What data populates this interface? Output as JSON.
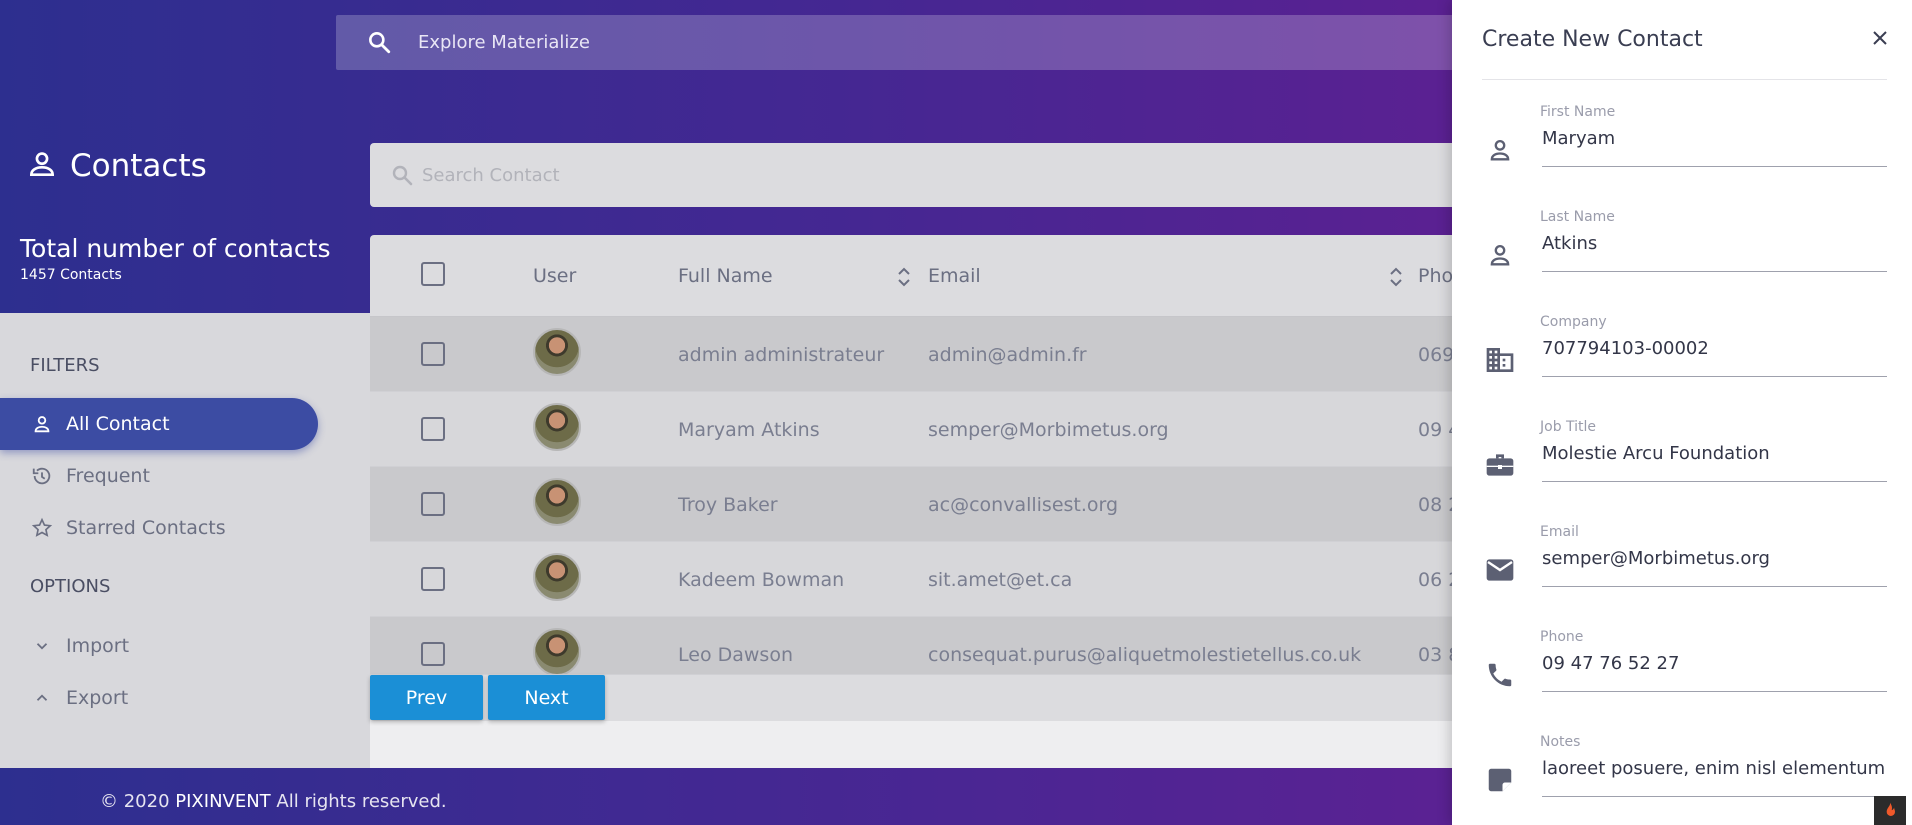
{
  "top_search": {
    "placeholder": "Explore Materialize"
  },
  "page": {
    "title": "Contacts",
    "total_label": "Total number of contacts",
    "total_count": "1457 Contacts"
  },
  "sidebar": {
    "filters_heading": "FILTERS",
    "filters": [
      {
        "label": "All Contact",
        "icon": "person-icon",
        "active": true
      },
      {
        "label": "Frequent",
        "icon": "history-icon",
        "active": false
      },
      {
        "label": "Starred Contacts",
        "icon": "star-icon",
        "active": false
      }
    ],
    "options_heading": "OPTIONS",
    "options": [
      {
        "label": "Import",
        "icon": "chevron-down-icon"
      },
      {
        "label": "Export",
        "icon": "chevron-up-icon"
      }
    ]
  },
  "contact_search": {
    "placeholder": "Search Contact"
  },
  "table": {
    "headers": {
      "user": "User",
      "full_name": "Full Name",
      "email": "Email",
      "phone": "Pho"
    },
    "rows": [
      {
        "name": "admin administrateur",
        "email": "admin@admin.fr",
        "phone": "069"
      },
      {
        "name": "Maryam Atkins",
        "email": "semper@Morbimetus.org",
        "phone": "09 4"
      },
      {
        "name": "Troy Baker",
        "email": "ac@convallisest.org",
        "phone": "08 2"
      },
      {
        "name": "Kadeem Bowman",
        "email": "sit.amet@et.ca",
        "phone": "06 2"
      },
      {
        "name": "Leo Dawson",
        "email": "consequat.purus@aliquetmolestietellus.co.uk",
        "phone": "03 8"
      }
    ]
  },
  "pager": {
    "prev": "Prev",
    "next": "Next"
  },
  "footer": {
    "prefix": "© 2020 ",
    "brand": "PIXINVENT",
    "suffix": " All rights reserved."
  },
  "panel": {
    "title": "Create New Contact",
    "fields": [
      {
        "label": "First Name",
        "value": "Maryam",
        "icon": "person-icon"
      },
      {
        "label": "Last Name",
        "value": "Atkins",
        "icon": "person-icon"
      },
      {
        "label": "Company",
        "value": "707794103-00002",
        "icon": "business-icon"
      },
      {
        "label": "Job Title",
        "value": "Molestie Arcu Foundation",
        "icon": "briefcase-icon"
      },
      {
        "label": "Email",
        "value": "semper@Morbimetus.org",
        "icon": "email-icon"
      },
      {
        "label": "Phone",
        "value": "09 47 76 52 27",
        "icon": "phone-icon"
      },
      {
        "label": "Notes",
        "value": "laoreet posuere, enim nisl elementum pu",
        "icon": "note-icon"
      }
    ]
  },
  "colors": {
    "header_gradient_start": "#2d2f8f",
    "header_gradient_end": "#6a1e93",
    "active_filter": "#3c4ca3",
    "button": "#1b8fd6"
  }
}
